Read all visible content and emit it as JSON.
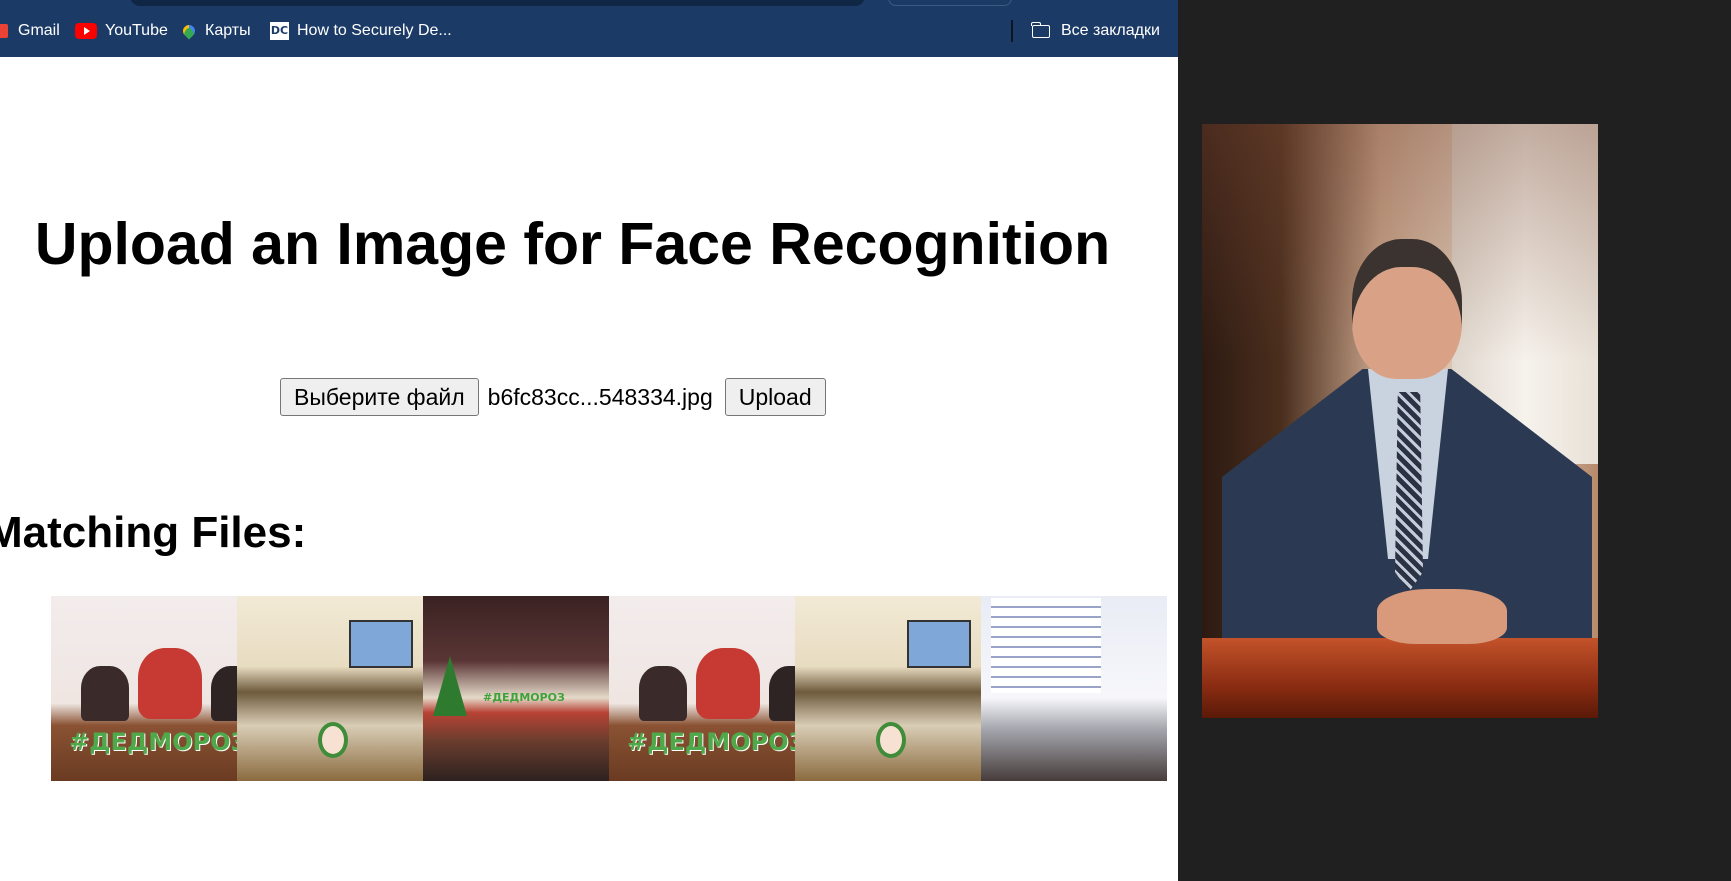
{
  "bookmarks_bar": {
    "items": [
      {
        "label": "Gmail",
        "icon": "gmail-icon"
      },
      {
        "label": "YouTube",
        "icon": "youtube-icon"
      },
      {
        "label": "Карты",
        "icon": "maps-pin-icon"
      },
      {
        "label": "How to Securely De...",
        "icon": "dc-icon"
      }
    ],
    "all_bookmarks": {
      "label": "Все закладки",
      "icon": "folder-icon"
    },
    "colors": {
      "background": "#1b3b66",
      "text": "#ffffff"
    }
  },
  "page": {
    "title": "Upload an Image for Face Recognition",
    "upload_form": {
      "choose_file_label": "Выберите файл",
      "selected_file_name": "b6fc83cc...548334.jpg",
      "upload_label": "Upload"
    },
    "matching_heading": "Matching Files:",
    "matching_thumbnails": [
      {
        "kind": "press-conference",
        "overlay_text": "#ДЕДМОРОЗНТВ"
      },
      {
        "kind": "council-hall",
        "overlay_text": ""
      },
      {
        "kind": "stage-event",
        "overlay_text": "#ДЕДМОРОЗ"
      },
      {
        "kind": "press-conference",
        "overlay_text": "#ДЕДМОРОЗНТВ"
      },
      {
        "kind": "council-hall",
        "overlay_text": ""
      },
      {
        "kind": "conference-slide",
        "overlay_text": ""
      }
    ]
  },
  "preview": {
    "subject": "portrait of a man in suit at desk",
    "background_color": "#202020"
  }
}
